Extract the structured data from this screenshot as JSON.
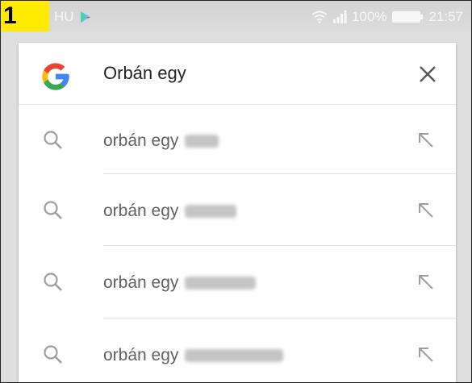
{
  "status_bar": {
    "badge": "1",
    "carrier": "HU",
    "battery": "100%",
    "time": "21:57"
  },
  "search": {
    "query": "Orbán egy",
    "logo_icon": "google-g-icon",
    "clear_icon": "close-icon"
  },
  "suggestions": [
    {
      "text": "orbán egy",
      "icon": "search-icon",
      "fill_icon": "arrow-up-left-icon"
    },
    {
      "text": "orbán egy",
      "icon": "search-icon",
      "fill_icon": "arrow-up-left-icon"
    },
    {
      "text": "orbán egy",
      "icon": "search-icon",
      "fill_icon": "arrow-up-left-icon"
    },
    {
      "text": "orbán egy",
      "icon": "search-icon",
      "fill_icon": "arrow-up-left-icon"
    }
  ],
  "colors": {
    "google_blue": "#4285F4",
    "google_red": "#EA4335",
    "google_yellow": "#FBBC05",
    "google_green": "#34A853",
    "badge_yellow": "#FFEA00"
  }
}
